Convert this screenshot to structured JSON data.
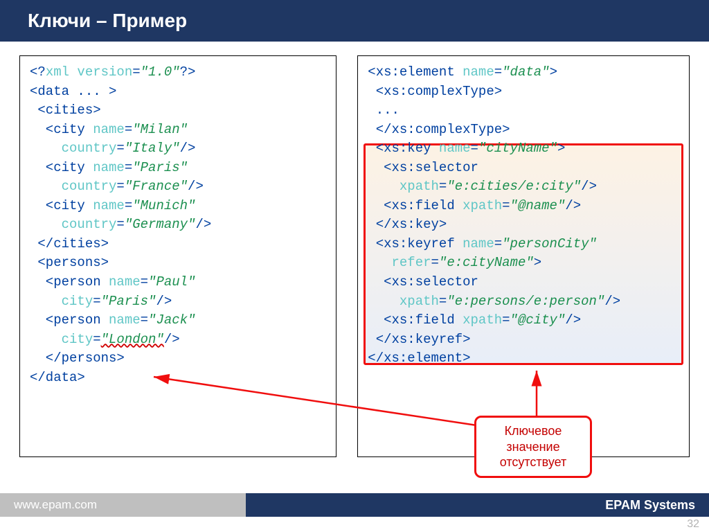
{
  "title": "Ключи – Пример",
  "left_code": {
    "l1a": "<?",
    "l1b": "xml version",
    "l1c": "=",
    "l1d": "\"1.0\"",
    "l1e": "?>",
    "l2": "<data ... >",
    "l3": " <cities>",
    "l4a": "  <city ",
    "l4b": "name",
    "l4c": "=",
    "l4d": "\"Milan\"",
    "l5a": "    country",
    "l5b": "=",
    "l5c": "\"Italy\"",
    "l5d": "/>",
    "l6a": "  <city ",
    "l6b": "name",
    "l6c": "=",
    "l6d": "\"Paris\"",
    "l7a": "    country",
    "l7b": "=",
    "l7c": "\"France\"",
    "l7d": "/>",
    "l8a": "  <city ",
    "l8b": "name",
    "l8c": "=",
    "l8d": "\"Munich\"",
    "l9a": "    country",
    "l9b": "=",
    "l9c": "\"Germany\"",
    "l9d": "/>",
    "l10": " </cities>",
    "l11": " <persons>",
    "l12a": "  <person ",
    "l12b": "name",
    "l12c": "=",
    "l12d": "\"Paul\"",
    "l13a": "    city",
    "l13b": "=",
    "l13c": "\"Paris\"",
    "l13d": "/>",
    "l14a": "  <person ",
    "l14b": "name",
    "l14c": "=",
    "l14d": "\"Jack\"",
    "l15a": "    city",
    "l15b": "=",
    "l15c": "\"London\"",
    "l15d": "/>",
    "l16": "  </persons>",
    "l17": "</data>"
  },
  "right_code": {
    "r1a": "<xs:element ",
    "r1b": "name",
    "r1c": "=",
    "r1d": "\"data\"",
    "r1e": ">",
    "r2": " <xs:complexType>",
    "r3": " ...",
    "r4": " </xs:complexType>",
    "r5a": " <xs:key ",
    "r5b": "name",
    "r5c": "=",
    "r5d": "\"cityName\"",
    "r5e": ">",
    "r6": "  <xs:selector",
    "r7a": "    xpath",
    "r7b": "=",
    "r7c": "\"e:cities/e:city\"",
    "r7d": "/>",
    "r8a": "  <xs:field ",
    "r8b": "xpath",
    "r8c": "=",
    "r8d": "\"@name\"",
    "r8e": "/>",
    "r9": " </xs:key>",
    "r10a": " <xs:keyref ",
    "r10b": "name",
    "r10c": "=",
    "r10d": "\"personCity\"",
    "r11a": "   refer",
    "r11b": "=",
    "r11c": "\"e:cityName\"",
    "r11d": ">",
    "r12": "  <xs:selector",
    "r13a": "    xpath",
    "r13b": "=",
    "r13c": "\"e:persons/e:person\"",
    "r13d": "/>",
    "r14a": "  <xs:field ",
    "r14b": "xpath",
    "r14c": "=",
    "r14d": "\"@city\"",
    "r14e": "/>",
    "r15": " </xs:keyref>",
    "r16": "</xs:element>"
  },
  "callout": "Ключевое значение отсутствует",
  "footer": {
    "url": "www.epam.com",
    "brand": "EPAM Systems"
  },
  "page": "32"
}
